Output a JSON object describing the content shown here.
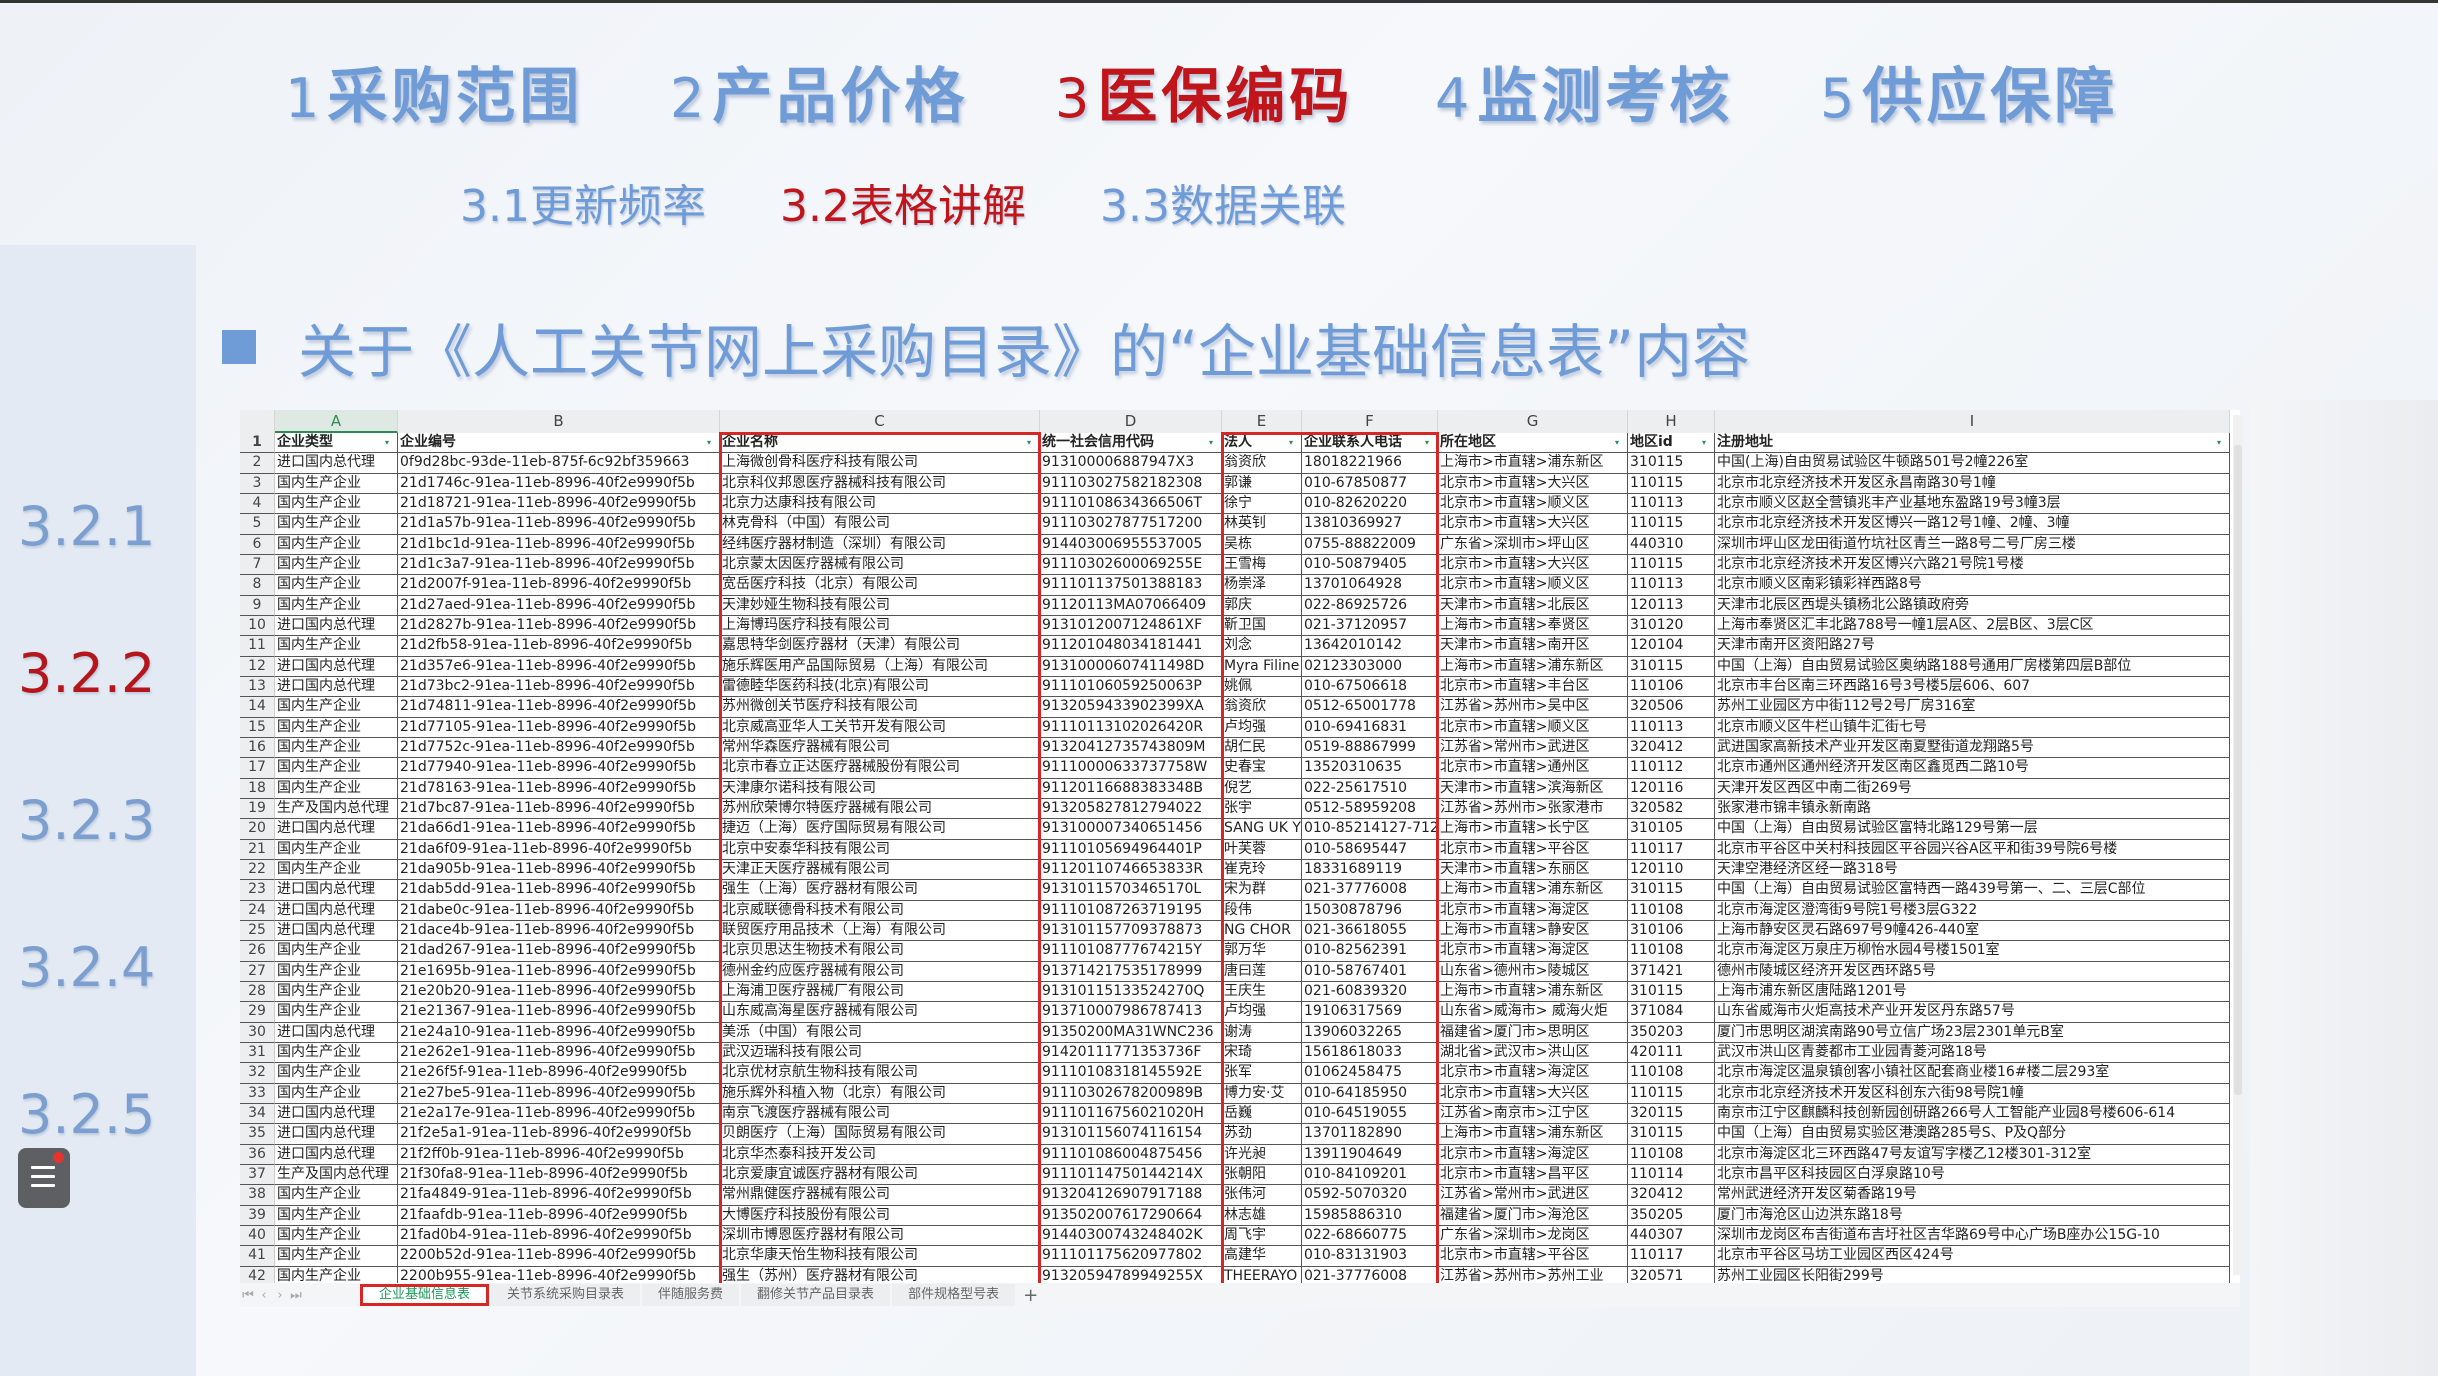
{
  "nav": {
    "items": [
      {
        "num": "1",
        "label": "采购范围",
        "active": false
      },
      {
        "num": "2",
        "label": "产品价格",
        "active": false
      },
      {
        "num": "3",
        "label": "医保编码",
        "active": true
      },
      {
        "num": "4",
        "label": "监测考核",
        "active": false
      },
      {
        "num": "5",
        "label": "供应保障",
        "active": false
      }
    ],
    "sub_items": [
      {
        "num": "3.1",
        "label": "更新频率",
        "active": false
      },
      {
        "num": "3.2",
        "label": "表格讲解",
        "active": true
      },
      {
        "num": "3.3",
        "label": "数据关联",
        "active": false
      }
    ]
  },
  "heading": "关于《人工关节网上采购目录》的“企业基础信息表”内容",
  "sidebar": {
    "items": [
      {
        "label": "3.2.1",
        "active": false
      },
      {
        "label": "3.2.2",
        "active": true
      },
      {
        "label": "3.2.3",
        "active": false
      },
      {
        "label": "3.2.4",
        "active": false
      },
      {
        "label": "3.2.5",
        "active": false
      }
    ]
  },
  "colors": {
    "accent_blue": "#6f9bd6",
    "active_red": "#c0161b",
    "highlight_box": "#d62626",
    "active_sheet_tab": "#1b9a58"
  },
  "sheet": {
    "selected_column": "A",
    "column_letters": [
      "A",
      "B",
      "C",
      "D",
      "E",
      "F",
      "G",
      "H",
      "I"
    ],
    "headers": [
      "企业类型",
      "企业编号",
      "企业名称",
      "统一社会信用代码",
      "法人",
      "企业联系人电话",
      "所在地区",
      "地区id",
      "注册地址"
    ],
    "highlighted_columns": [
      "C",
      "E",
      "F"
    ],
    "rows": [
      [
        "进口国内总代理",
        "0f9d28bc-93de-11eb-875f-6c92bf359663",
        "上海微创骨科医疗科技有限公司",
        "913100006887947X3",
        "翁资欣",
        "18018221966",
        "上海市>市直辖>浦东新区",
        "310115",
        "中国(上海)自由贸易试验区牛顿路501号2幢226室"
      ],
      [
        "国内生产企业",
        "21d1746c-91ea-11eb-8996-40f2e9990f5b",
        "北京科仪邦恩医疗器械科技有限公司",
        "911103027582182308",
        "郭谦",
        "010-67850877",
        "北京市>市直辖>大兴区",
        "110115",
        "北京市北京经济技术开发区永昌南路30号1幢"
      ],
      [
        "国内生产企业",
        "21d18721-91ea-11eb-8996-40f2e9990f5b",
        "北京力达康科技有限公司",
        "91110108634366506T",
        "徐宁",
        "010-82620220",
        "北京市>市直辖>顺义区",
        "110113",
        "北京市顺义区赵全营镇兆丰产业基地东盈路19号3幢3层"
      ],
      [
        "国内生产企业",
        "21d1a57b-91ea-11eb-8996-40f2e9990f5b",
        "林克骨科（中国）有限公司",
        "911103027877517200",
        "林英钊",
        "13810369927",
        "北京市>市直辖>大兴区",
        "110115",
        "北京市北京经济技术开发区博兴一路12号1幢、2幢、3幢"
      ],
      [
        "国内生产企业",
        "21d1bc1d-91ea-11eb-8996-40f2e9990f5b",
        "经纬医疗器材制造（深圳）有限公司",
        "914403006955537005",
        "吴栋",
        "0755-88822009",
        "广东省>深圳市>坪山区",
        "440310",
        "深圳市坪山区龙田街道竹坑社区青兰一路8号二号厂房三楼"
      ],
      [
        "国内生产企业",
        "21d1c3a7-91ea-11eb-8996-40f2e9990f5b",
        "北京蒙太因医疗器械有限公司",
        "91110302600069255E",
        "王雪梅",
        "010-50879405",
        "北京市>市直辖>大兴区",
        "110115",
        "北京市北京经济技术开发区博兴六路21号院1号楼"
      ],
      [
        "国内生产企业",
        "21d2007f-91ea-11eb-8996-40f2e9990f5b",
        "宽岳医疗科技（北京）有限公司",
        "911101137501388183",
        "杨崇泽",
        "13701064928",
        "北京市>市直辖>顺义区",
        "110113",
        "北京市顺义区南彩镇彩祥西路8号"
      ],
      [
        "国内生产企业",
        "21d27aed-91ea-11eb-8996-40f2e9990f5b",
        "天津妙娅生物科技有限公司",
        "91120113MA07066409",
        "郭庆",
        "022-86925726",
        "天津市>市直辖>北辰区",
        "120113",
        "天津市北辰区西堤头镇杨北公路镇政府旁"
      ],
      [
        "进口国内总代理",
        "21d2827b-91ea-11eb-8996-40f2e9990f5b",
        "上海博玛医疗科技有限公司",
        "9131012007124861XF",
        "靳卫国",
        "021-37120957",
        "上海市>市直辖>奉贤区",
        "310120",
        "上海市奉贤区汇丰北路788号一幢1层A区、2层B区、3层C区"
      ],
      [
        "国内生产企业",
        "21d2fb58-91ea-11eb-8996-40f2e9990f5b",
        "嘉思特华剑医疗器材（天津）有限公司",
        "911201048034181441",
        "刘念",
        "13642010142",
        "天津市>市直辖>南开区",
        "120104",
        "天津市南开区资阳路27号"
      ],
      [
        "进口国内总代理",
        "21d357e6-91ea-11eb-8996-40f2e9990f5b",
        "施乐辉医用产品国际贸易（上海）有限公司",
        "91310000607411498D",
        "Myra Filine",
        "02123303000",
        "上海市>市直辖>浦东新区",
        "310115",
        "中国（上海）自由贸易试验区奥纳路188号通用厂房楼第四层B部位"
      ],
      [
        "进口国内总代理",
        "21d73bc2-91ea-11eb-8996-40f2e9990f5b",
        "雷德睦华医药科技(北京)有限公司",
        "91110106059250063P",
        "姚佩",
        "010-67506618",
        "北京市>市直辖>丰台区",
        "110106",
        "北京市丰台区南三环西路16号3号楼5层606、607"
      ],
      [
        "国内生产企业",
        "21d74811-91ea-11eb-8996-40f2e9990f5b",
        "苏州微创关节医疗科技有限公司",
        "9132059433902399XA",
        "翁资欣",
        "0512-65001778",
        "江苏省>苏州市>吴中区",
        "320506",
        "苏州工业园区方中街112号2号厂房316室"
      ],
      [
        "国内生产企业",
        "21d77105-91ea-11eb-8996-40f2e9990f5b",
        "北京威高亚华人工关节开发有限公司",
        "91110113102026420R",
        "卢均强",
        "010-69416831",
        "北京市>市直辖>顺义区",
        "110113",
        "北京市顺义区牛栏山镇牛汇街七号"
      ],
      [
        "国内生产企业",
        "21d7752c-91ea-11eb-8996-40f2e9990f5b",
        "常州华森医疗器械有限公司",
        "91320412735743809M",
        "胡仁民",
        "0519-88867999",
        "江苏省>常州市>武进区",
        "320412",
        "武进国家高新技术产业开发区南夏墅街道龙翔路5号"
      ],
      [
        "国内生产企业",
        "21d77940-91ea-11eb-8996-40f2e9990f5b",
        "北京市春立正达医疗器械股份有限公司",
        "91110000633737758W",
        "史春宝",
        "13520310635",
        "北京市>市直辖>通州区",
        "110112",
        "北京市通州区通州经济开发区南区鑫觅西二路10号"
      ],
      [
        "国内生产企业",
        "21d78163-91ea-11eb-8996-40f2e9990f5b",
        "天津康尔诺科技有限公司",
        "91120116688383348B",
        "倪艺",
        "022-25617510",
        "天津市>市直辖>滨海新区",
        "120116",
        "天津开发区西区中南二街269号"
      ],
      [
        "生产及国内总代理",
        "21d7bc87-91ea-11eb-8996-40f2e9990f5b",
        "苏州欣荣博尔特医疗器械有限公司",
        "913205827812794022",
        "张宇",
        "0512-58959208",
        "江苏省>苏州市>张家港市",
        "320582",
        "张家港市锦丰镇永新南路"
      ],
      [
        "进口国内总代理",
        "21da66d1-91ea-11eb-8996-40f2e9990f5b",
        "捷迈（上海）医疗国际贸易有限公司",
        "913100007340651456",
        "SANG UK Y",
        "010-85214127-712",
        "上海市>市直辖>长宁区",
        "310105",
        "中国（上海）自由贸易试验区富特北路129号第一层"
      ],
      [
        "国内生产企业",
        "21da6f09-91ea-11eb-8996-40f2e9990f5b",
        "北京中安泰华科技有限公司",
        "91110105694964401P",
        "叶芙蓉",
        "010-58695447",
        "北京市>市直辖>平谷区",
        "110117",
        "北京市平谷区中关村科技园区平谷园兴谷A区平和街39号院6号楼"
      ],
      [
        "国内生产企业",
        "21da905b-91ea-11eb-8996-40f2e9990f5b",
        "天津正天医疗器械有限公司",
        "91120110746653833R",
        "崔克玲",
        "18331689119",
        "天津市>市直辖>东丽区",
        "120110",
        "天津空港经济区经一路318号"
      ],
      [
        "进口国内总代理",
        "21dab5dd-91ea-11eb-8996-40f2e9990f5b",
        "强生（上海）医疗器材有限公司",
        "91310115703465170L",
        "宋为群",
        "021-37776008",
        "上海市>市直辖>浦东新区",
        "310115",
        "中国（上海）自由贸易试验区富特西一路439号第一、二、三层C部位"
      ],
      [
        "进口国内总代理",
        "21dabe0c-91ea-11eb-8996-40f2e9990f5b",
        "北京威联德骨科技术有限公司",
        "911101087263719195",
        "段伟",
        "15030878796",
        "北京市>市直辖>海淀区",
        "110108",
        "北京市海淀区澄湾街9号院1号楼3层G322"
      ],
      [
        "进口国内总代理",
        "21dace4b-91ea-11eb-8996-40f2e9990f5b",
        "联贸医疗用品技术（上海）有限公司",
        "913101157709378873",
        "NG CHOR",
        "021-36618055",
        "上海市>市直辖>静安区",
        "310106",
        "上海市静安区灵石路697号9幢426-440室"
      ],
      [
        "国内生产企业",
        "21dad267-91ea-11eb-8996-40f2e9990f5b",
        "北京贝思达生物技术有限公司",
        "91110108777674215Y",
        "郭万华",
        "010-82562391",
        "北京市>市直辖>海淀区",
        "110108",
        "北京市海淀区万泉庄万柳怡水园4号楼1501室"
      ],
      [
        "国内生产企业",
        "21e1695b-91ea-11eb-8996-40f2e9990f5b",
        "德州金约应医疗器械有限公司",
        "913714217535178999",
        "唐曰莲",
        "010-58767401",
        "山东省>德州市>陵城区",
        "371421",
        "德州市陵城区经济开发区西环路5号"
      ],
      [
        "国内生产企业",
        "21e20b20-91ea-11eb-8996-40f2e9990f5b",
        "上海浦卫医疗器械厂有限公司",
        "91310115133524270Q",
        "王庆生",
        "021-60839320",
        "上海市>市直辖>浦东新区",
        "310115",
        "上海市浦东新区唐陆路1201号"
      ],
      [
        "国内生产企业",
        "21e21367-91ea-11eb-8996-40f2e9990f5b",
        "山东威高海星医疗器械有限公司",
        "913710007986787413",
        "卢均强",
        "19106317569",
        "山东省>威海市> 威海火炬",
        "371084",
        "山东省威海市火炬高技术产业开发区丹东路57号"
      ],
      [
        "进口国内总代理",
        "21e24a10-91ea-11eb-8996-40f2e9990f5b",
        "美泺（中国）有限公司",
        "91350200MA31WNC236",
        "谢涛",
        "13906032265",
        "福建省>厦门市>思明区",
        "350203",
        "厦门市思明区湖滨南路90号立信广场23层2301单元B室"
      ],
      [
        "国内生产企业",
        "21e262e1-91ea-11eb-8996-40f2e9990f5b",
        "武汉迈瑞科技有限公司",
        "91420111771353736F",
        "宋琦",
        "15618618033",
        "湖北省>武汉市>洪山区",
        "420111",
        "武汉市洪山区青菱都市工业园青菱河路18号"
      ],
      [
        "国内生产企业",
        "21e26f5f-91ea-11eb-8996-40f2e9990f5b",
        "北京优材京航生物科技有限公司",
        "91110108318145592E",
        "张军",
        "01062458475",
        "北京市>市直辖>海淀区",
        "110108",
        "北京市海淀区温泉镇创客小镇社区配套商业楼16#楼二层293室"
      ],
      [
        "国内生产企业",
        "21e27be5-91ea-11eb-8996-40f2e9990f5b",
        "施乐辉外科植入物（北京）有限公司",
        "91110302678200989B",
        "博力安·艾",
        "010-64185950",
        "北京市>市直辖>大兴区",
        "110115",
        "北京市北京经济技术开发区科创东六街98号院1幢"
      ],
      [
        "进口国内总代理",
        "21e2a17e-91ea-11eb-8996-40f2e9990f5b",
        "南京飞渡医疗器械有限公司",
        "91110116756021020H",
        "岳巍",
        "010-64519055",
        "江苏省>南京市>江宁区",
        "320115",
        "南京市江宁区麒麟科技创新园创研路266号人工智能产业园8号楼606-614"
      ],
      [
        "进口国内总代理",
        "21f2e5a1-91ea-11eb-8996-40f2e9990f5b",
        "贝朗医疗（上海）国际贸易有限公司",
        "913101156074116154",
        "苏劲",
        "13701182890",
        "上海市>市直辖>浦东新区",
        "310115",
        "中国（上海）自由贸易实验区港澳路285号S、P及Q部分"
      ],
      [
        "进口国内总代理",
        "21f2ff0b-91ea-11eb-8996-40f2e9990f5b",
        "北京华杰泰科技开发公司",
        "911101086004875456",
        "许光昶",
        "13911904649",
        "北京市>市直辖>海淀区",
        "110108",
        "北京市海淀区北三环西路47号友谊写字楼乙12楼301-312室"
      ],
      [
        "生产及国内总代理",
        "21f30fa8-91ea-11eb-8996-40f2e9990f5b",
        "北京爱康宜诚医疗器材有限公司",
        "91110114750144214X",
        "张朝阳",
        "010-84109201",
        "北京市>市直辖>昌平区",
        "110114",
        "北京市昌平区科技园区白浮泉路10号"
      ],
      [
        "国内生产企业",
        "21fa4849-91ea-11eb-8996-40f2e9990f5b",
        "常州鼎健医疗器械有限公司",
        "913204126907917188",
        "张伟河",
        "0592-5070320",
        "江苏省>常州市>武进区",
        "320412",
        "常州武进经济开发区菊香路19号"
      ],
      [
        "国内生产企业",
        "21faafdb-91ea-11eb-8996-40f2e9990f5b",
        "大博医疗科技股份有限公司",
        "913502007617290664",
        "林志雄",
        "15985886310",
        "福建省>厦门市>海沧区",
        "350205",
        "厦门市海沧区山边洪东路18号"
      ],
      [
        "国内生产企业",
        "21fad0b4-91ea-11eb-8996-40f2e9990f5b",
        "深圳市博恩医疗器材有限公司",
        "91440300743248402K",
        "周飞宇",
        "022-68660775",
        "广东省>深圳市>龙岗区",
        "440307",
        "深圳市龙岗区布吉街道布吉圩社区吉华路69号中心广场B座办公15G-10"
      ],
      [
        "国内生产企业",
        "2200b52d-91ea-11eb-8996-40f2e9990f5b",
        "北京华康天怡生物科技有限公司",
        "911101175620977802",
        "高建华",
        "010-83131903",
        "北京市>市直辖>平谷区",
        "110117",
        "北京市平谷区马坊工业园区西区424号"
      ],
      [
        "国内生产企业",
        "2200b955-91ea-11eb-8996-40f2e9990f5b",
        "强生（苏州）医疗器材有限公司",
        "91320594789949255X",
        "THEERAYO",
        "021-37776008",
        "江苏省>苏州市>苏州工业",
        "320571",
        "苏州工业园区长阳街299号"
      ]
    ],
    "tabs": [
      {
        "label": "企业基础信息表",
        "active": true
      },
      {
        "label": "关节系统采购目录表",
        "active": false
      },
      {
        "label": "伴随服务费",
        "active": false
      },
      {
        "label": "翻修关节产品目录表",
        "active": false
      },
      {
        "label": "部件规格型号表",
        "active": false
      }
    ],
    "add_tab_label": "+"
  }
}
